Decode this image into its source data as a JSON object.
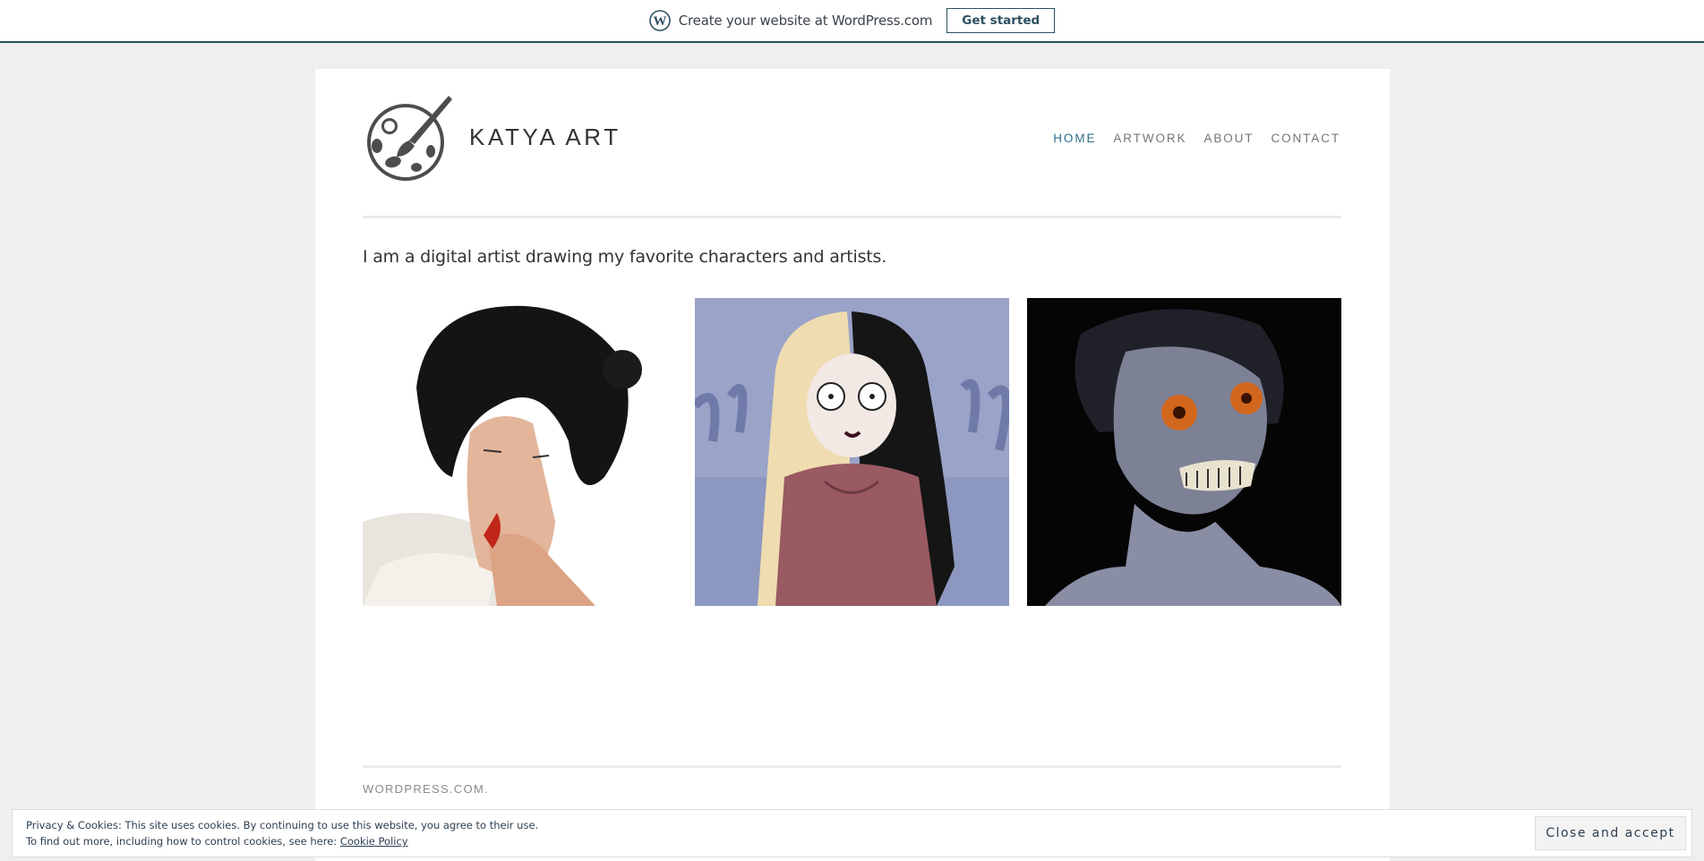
{
  "wpbar": {
    "logo_icon": "wordpress-logo-icon",
    "text": "Create your website at WordPress.com",
    "button_label": "Get started"
  },
  "site": {
    "logo_icon": "paint-palette-brush-icon",
    "title": "KATYA ART"
  },
  "nav": {
    "items": [
      {
        "label": "HOME",
        "active": true
      },
      {
        "label": "ARTWORK",
        "active": false
      },
      {
        "label": "ABOUT",
        "active": false
      },
      {
        "label": "CONTACT",
        "active": false
      }
    ]
  },
  "intro": "I am a digital artist drawing my favorite characters and artists.",
  "gallery": {
    "images": [
      {
        "subject": "dark-haired woman in white robe artwork"
      },
      {
        "subject": "half-blonde half-black haired girl in rose dress artwork"
      },
      {
        "subject": "grey skull-faced shinigami artwork"
      }
    ]
  },
  "footer": {
    "credit": "WORDPRESS.COM."
  },
  "cookie": {
    "line1": "Privacy & Cookies: This site uses cookies. By continuing to use this website, you agree to their use.",
    "line2_prefix": "To find out more, including how to control cookies, see here:",
    "policy_link": "Cookie Policy",
    "button_label": "Close and accept"
  },
  "colors": {
    "accent": "#2c6e8a",
    "bar_border": "#2c4f5f",
    "page_bg": "#efefef"
  }
}
